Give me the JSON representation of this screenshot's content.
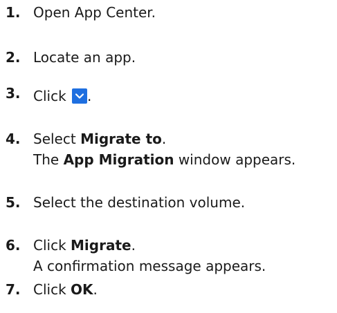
{
  "steps": [
    {
      "number": "1.",
      "text": "Open App Center."
    },
    {
      "number": "2.",
      "text": "Locate an app."
    },
    {
      "number": "3.",
      "prefix": "Click ",
      "icon": "chevron-down-icon",
      "suffix": ".",
      "accent": "#1e6fe0"
    },
    {
      "number": "4.",
      "pre": "Select ",
      "bold": "Migrate to",
      "post": ".",
      "line2_pre": "The ",
      "line2_bold": "App Migration",
      "line2_post": " window appears."
    },
    {
      "number": "5.",
      "text": "Select the destination volume."
    },
    {
      "number": "6.",
      "pre": "Click ",
      "bold": "Migrate",
      "post": ".",
      "line2": "A confirmation message appears."
    },
    {
      "number": "7.",
      "pre": "Click ",
      "bold": "OK",
      "post": "."
    }
  ]
}
